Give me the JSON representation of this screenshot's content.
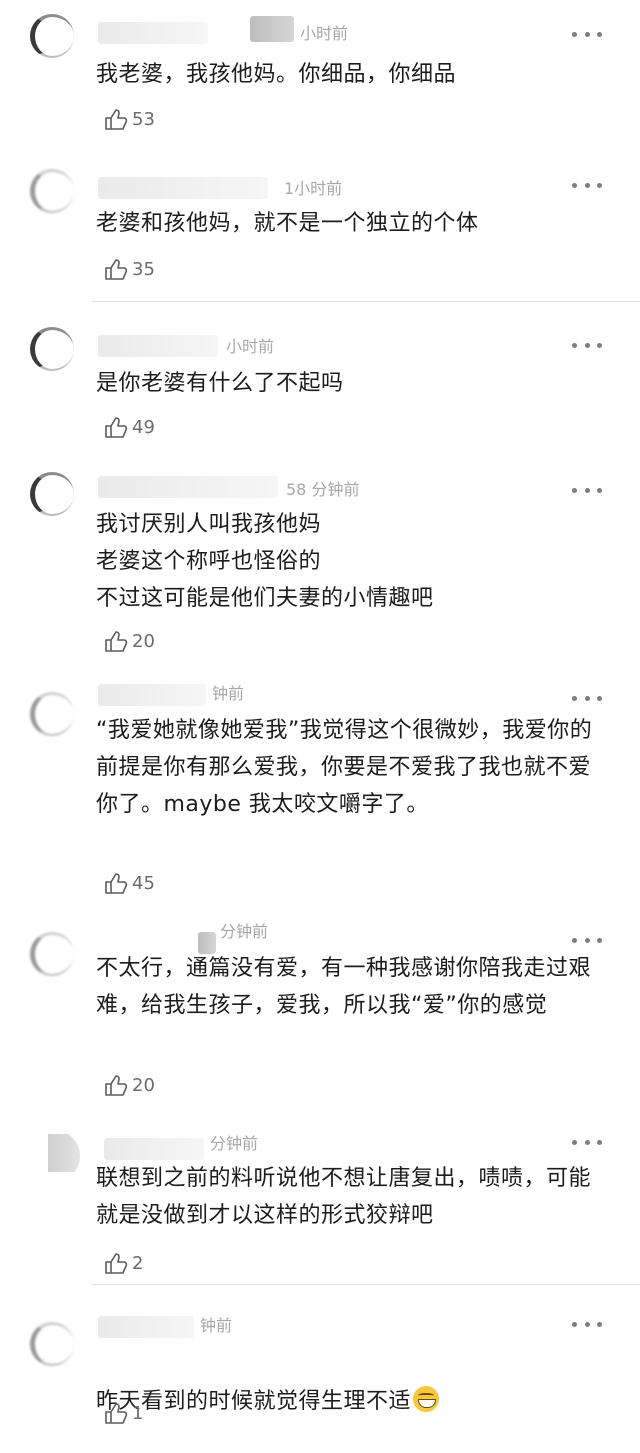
{
  "comments": [
    {
      "timestamp": "小时前",
      "text": "我老婆，我孩他妈。你细品，你细品",
      "likes": "53"
    },
    {
      "timestamp": "1小时前",
      "text": "老婆和孩他妈，就不是一个独立的个体",
      "likes": "35"
    },
    {
      "timestamp": "小时前",
      "text": "是你老婆有什么了不起吗",
      "likes": "49"
    },
    {
      "timestamp": "58 分钟前",
      "text": "我讨厌别人叫我孩他妈\n老婆这个称呼也怪俗的\n不过这可能是他们夫妻的小情趣吧",
      "likes": "20"
    },
    {
      "timestamp": "钟前",
      "text": "“我爱她就像她爱我”我觉得这个很微妙，我爱你的前提是你有那么爱我，你要是不爱我了我也就不爱你了。maybe 我太咬文嚼字了。",
      "likes": "45"
    },
    {
      "timestamp": "分钟前",
      "text": "不太行，通篇没有爱，有一种我感谢你陪我走过艰难，给我生孩子，爱我，所以我“爱”你的感觉",
      "likes": "20"
    },
    {
      "timestamp": "分钟前",
      "text": "联想到之前的料听说他不想让唐复出，啧啧，可能就是没做到才以这样的形式狡辩吧",
      "likes": "2"
    },
    {
      "timestamp": "钟前",
      "text": "昨天看到的时候就觉得生理不适",
      "likes": "1"
    }
  ],
  "icons": {
    "like": "thumbs-up-icon",
    "more": "more-dots-icon",
    "emoji": "grinning-sweat-emoji"
  }
}
